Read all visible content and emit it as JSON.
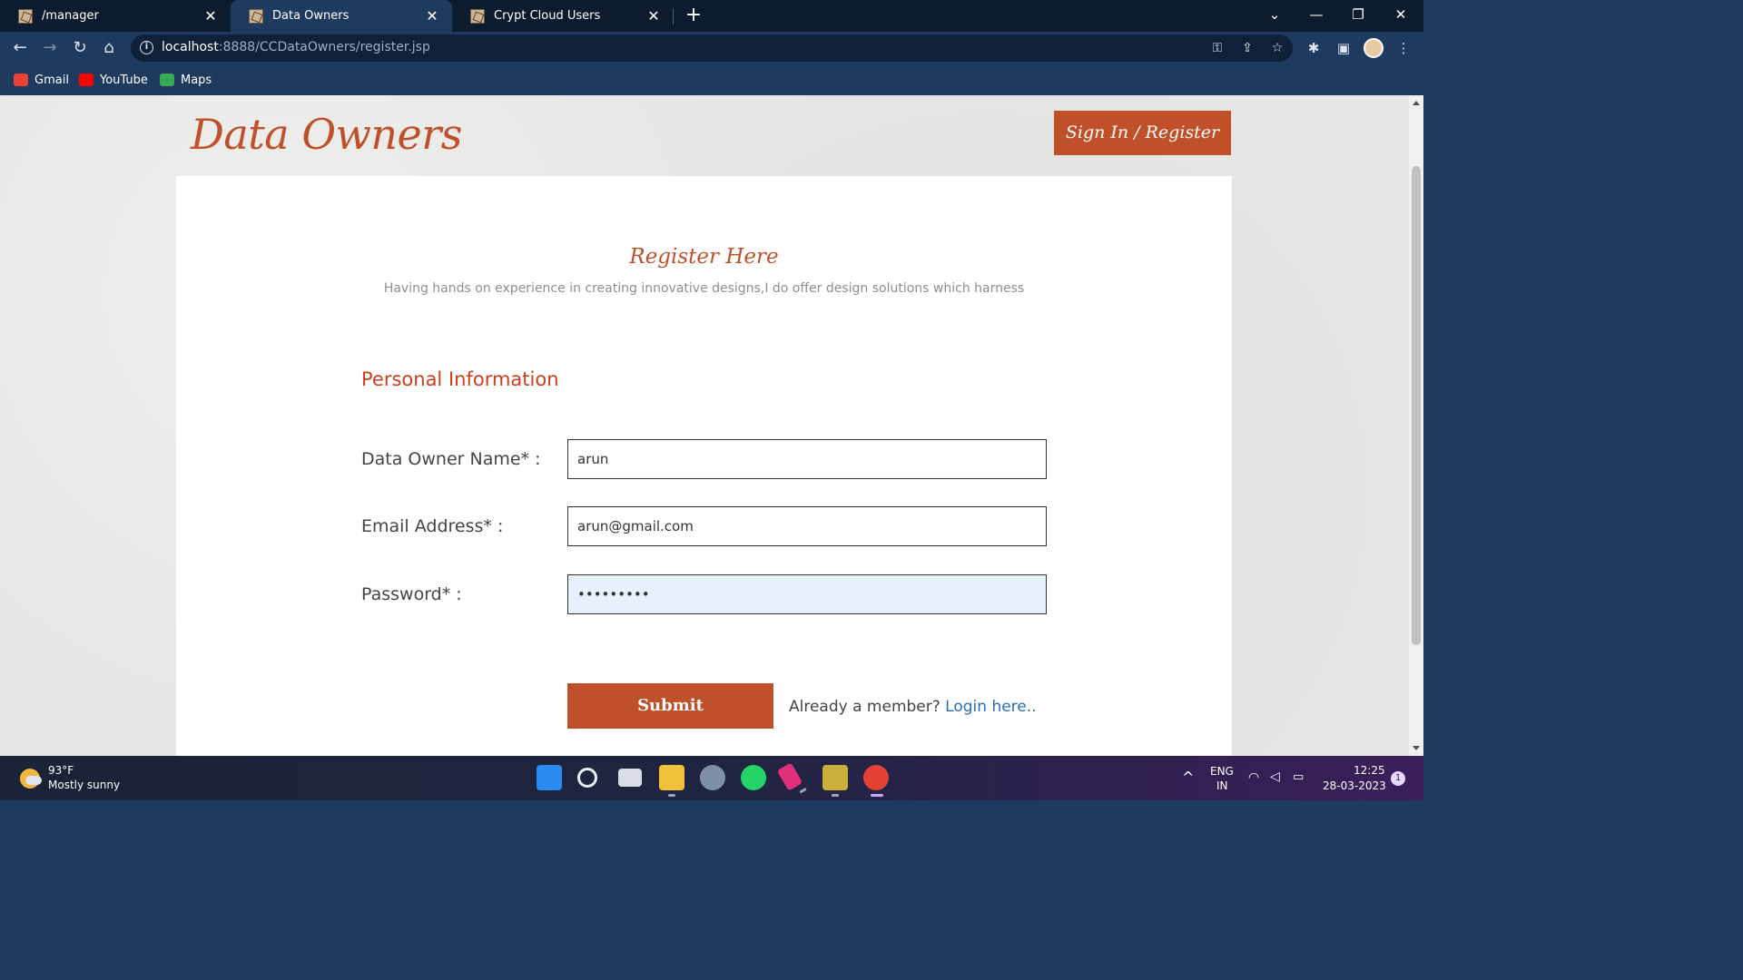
{
  "browser": {
    "tabs": [
      {
        "title": "/manager",
        "active": false
      },
      {
        "title": "Data Owners",
        "active": true
      },
      {
        "title": "Crypt Cloud Users",
        "active": false
      }
    ],
    "url_host": "localhost",
    "url_rest": ":8888/CCDataOwners/register.jsp",
    "bookmarks": [
      {
        "label": "Gmail",
        "icon": "gmail-icon",
        "color": "#ea4335"
      },
      {
        "label": "YouTube",
        "icon": "youtube-icon",
        "color": "#ff0000"
      },
      {
        "label": "Maps",
        "icon": "maps-icon",
        "color": "#34a853"
      }
    ]
  },
  "page": {
    "site_title": "Data Owners",
    "signin_label": "Sign In / Register",
    "register_title": "Register Here",
    "register_subtitle": "Having hands on experience in creating innovative designs,I do offer design solutions which harness",
    "section_title": "Personal Information",
    "fields": [
      {
        "label": "Data Owner Name* :",
        "value": "arun",
        "type": "text"
      },
      {
        "label": "Email Address* :",
        "value": "arun@gmail.com",
        "type": "text"
      },
      {
        "label": "Password* :",
        "value": "arun12345",
        "type": "password"
      }
    ],
    "submit_label": "Submit",
    "member_text": "Already a member?",
    "login_link": "Login here.."
  },
  "taskbar": {
    "weather_temp": "93°F",
    "weather_desc": "Mostly sunny",
    "lang_top": "ENG",
    "lang_bottom": "IN",
    "time": "12:25",
    "date": "28-03-2023",
    "notification_count": "1"
  },
  "colors": {
    "brand": "#c0502a",
    "link": "#2a6db5",
    "chrome_frame": "#1f3a5f"
  }
}
